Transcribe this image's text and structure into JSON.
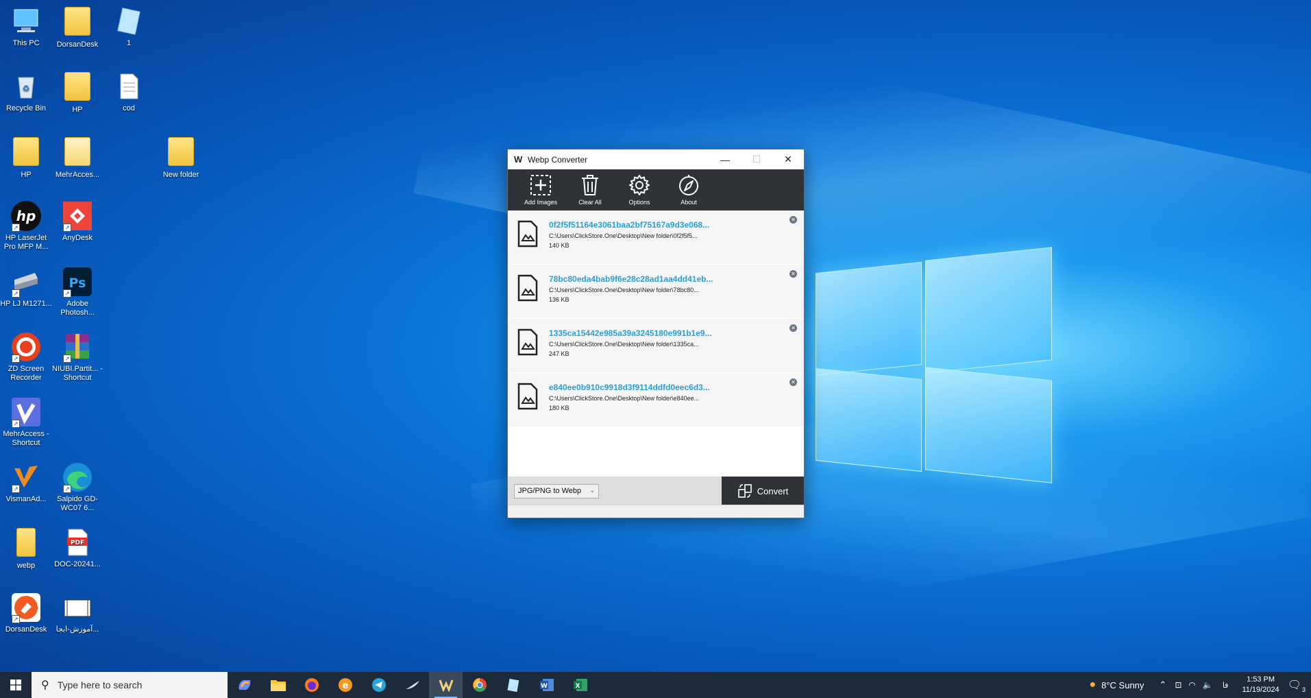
{
  "desktop": {
    "icons": [
      {
        "label": "This PC"
      },
      {
        "label": "DorsanDesk"
      },
      {
        "label": "1"
      },
      {
        "label": "Recycle Bin"
      },
      {
        "label": "HP"
      },
      {
        "label": "cod"
      },
      {
        "label": "HP"
      },
      {
        "label": "MehrAcces..."
      },
      {
        "label": "New folder"
      },
      {
        "label": "HP LaserJet Pro MFP M..."
      },
      {
        "label": "AnyDesk"
      },
      {
        "label": "HP LJ M1271..."
      },
      {
        "label": "Adobe Photosh..."
      },
      {
        "label": "ZD Screen Recorder"
      },
      {
        "label": "NIUBI.Partit... - Shortcut"
      },
      {
        "label": "MehrAccess - Shortcut"
      },
      {
        "label": "VismanAd..."
      },
      {
        "label": "Salpido GD-WC07 6..."
      },
      {
        "label": "webp"
      },
      {
        "label": "DOC-20241..."
      },
      {
        "label": "DorsanDesk"
      },
      {
        "label": "آموزش-ایجا..."
      }
    ]
  },
  "window": {
    "title": "Webp Converter",
    "toolbar": [
      {
        "label": "Add Images"
      },
      {
        "label": "Clear All"
      },
      {
        "label": "Options"
      },
      {
        "label": "About"
      }
    ],
    "files": [
      {
        "name": "0f2f5f51164e3061baa2bf75167a9d3e068...",
        "path": "C:\\Users\\ClickStore.One\\Desktop\\New folder\\0f2f5f5...",
        "size": "140 KB"
      },
      {
        "name": "78bc80eda4bab9f6e28c28ad1aa4dd41eb...",
        "path": "C:\\Users\\ClickStore.One\\Desktop\\New folder\\78bc80...",
        "size": "136 KB"
      },
      {
        "name": "1335ca15442e985a39a3245180e991b1e9...",
        "path": "C:\\Users\\ClickStore.One\\Desktop\\New folder\\1335ca...",
        "size": "247 KB"
      },
      {
        "name": "e840ee0b910c9918d3f9114ddfd0eec6d3...",
        "path": "C:\\Users\\ClickStore.One\\Desktop\\New folder\\e840ee...",
        "size": "180 KB"
      }
    ],
    "mode_select": "JPG/PNG to Webp",
    "convert_label": "Convert"
  },
  "taskbar": {
    "search_placeholder": "Type here to search",
    "weather": "8°C  Sunny",
    "lang": "فا",
    "time": "1:53 PM",
    "date": "11/19/2024",
    "notifications": "3"
  }
}
